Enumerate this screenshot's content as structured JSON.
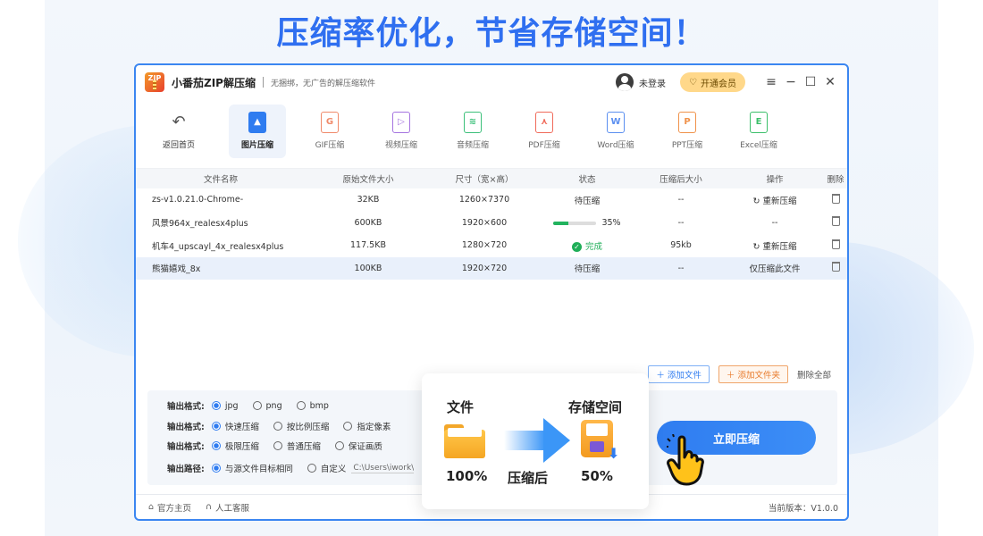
{
  "headline": "压缩率优化，节省存储空间！",
  "window": {
    "app_logo_text": "ZIP",
    "app_title": "小番茄ZIP解压缩",
    "tagline": "无捆绑，无广告的解压缩软件",
    "login": "未登录",
    "vip": "开通会员",
    "controls": [
      "≡",
      "−",
      "☐",
      "✕"
    ]
  },
  "toolbar": {
    "back": "返回首页",
    "tools": [
      {
        "icon": "image-icon",
        "glyph": "▲",
        "label": "图片压缩",
        "color": "#2f7cf0"
      },
      {
        "icon": "gif-icon",
        "glyph": "G",
        "label": "GIF压缩",
        "color": "#f08a6a"
      },
      {
        "icon": "video-icon",
        "glyph": "▷",
        "label": "视频压缩",
        "color": "#a574e0"
      },
      {
        "icon": "audio-icon",
        "glyph": "≋",
        "label": "音频压缩",
        "color": "#3cc07a"
      },
      {
        "icon": "pdf-icon",
        "glyph": "⋏",
        "label": "PDF压缩",
        "color": "#f06a5a"
      },
      {
        "icon": "word-icon",
        "glyph": "W",
        "label": "Word压缩",
        "color": "#5b8ff0"
      },
      {
        "icon": "ppt-icon",
        "glyph": "P",
        "label": "PPT压缩",
        "color": "#f0924a"
      },
      {
        "icon": "excel-icon",
        "glyph": "E",
        "label": "Excel压缩",
        "color": "#3cbf6a"
      }
    ]
  },
  "table": {
    "headers": [
      "文件名称",
      "原始文件大小",
      "尺寸（宽×高）",
      "状态",
      "压缩后大小",
      "操作",
      "删除"
    ],
    "rows": [
      {
        "name": "zs-v1.0.21.0-Chrome-",
        "size": "32KB",
        "dims": "1260×7370",
        "status": "待压缩",
        "after": "--",
        "action": "重新压缩"
      },
      {
        "name": "风景964x_realesx4plus",
        "size": "600KB",
        "dims": "1920×600",
        "status": "35%",
        "progress": 0.35,
        "after": "--",
        "action": "--"
      },
      {
        "name": "机车4_upscayl_4x_realesx4plus",
        "size": "117.5KB",
        "dims": "1280×720",
        "status": "完成",
        "after": "95kb",
        "action": "重新压缩"
      },
      {
        "name": "熊猫嬉戏_8x",
        "size": "100KB",
        "dims": "1920×720",
        "status": "待压缩",
        "after": "--",
        "action": "仅压缩此文件"
      }
    ]
  },
  "file_actions": {
    "add_file": "添加文件",
    "add_folder": "添加文件夹",
    "delete_all": "删除全部"
  },
  "settings": {
    "row1": {
      "label": "输出格式:",
      "options": [
        "jpg",
        "png",
        "bmp"
      ]
    },
    "row2": {
      "label": "输出格式:",
      "options": [
        "快速压缩",
        "按比例压缩",
        "指定像素"
      ]
    },
    "row3": {
      "label": "输出格式:",
      "options": [
        "极限压缩",
        "普通压缩",
        "保证画质"
      ]
    },
    "row4": {
      "label": "输出路径:",
      "options": [
        "与源文件目标相同",
        "自定义"
      ],
      "path": "C:\\Users\\iwork\\"
    }
  },
  "compress_button": "立即压缩",
  "statusbar": {
    "home": "官方主页",
    "service": "人工客服",
    "version": "当前版本：V1.0.0"
  },
  "popup": {
    "file_label": "文件",
    "storage_label": "存储空间",
    "before_pct": "100%",
    "after_label": "压缩后",
    "after_pct": "50%"
  }
}
